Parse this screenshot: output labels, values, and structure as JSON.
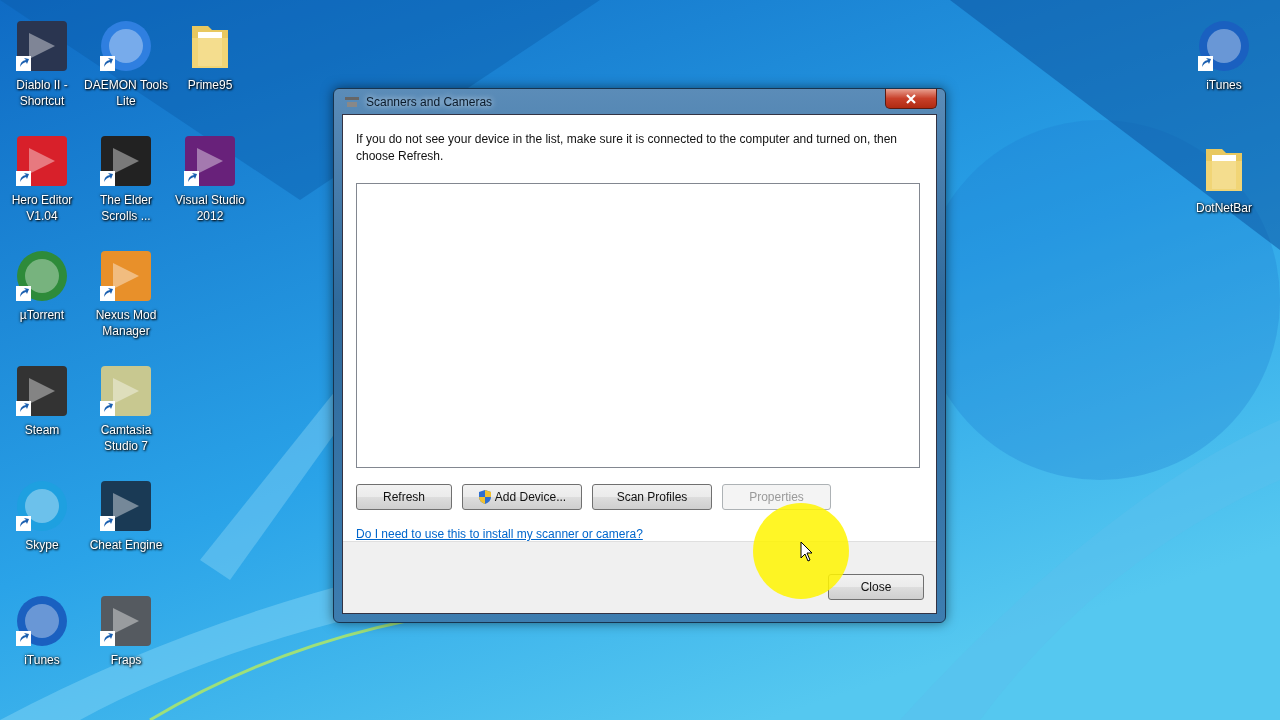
{
  "desktop": {
    "icon_rows": [
      [
        {
          "label": "Diablo II - Shortcut",
          "kind": "app",
          "color": "#2a3550",
          "shortcut": true
        },
        {
          "label": "DAEMON Tools Lite",
          "kind": "disc",
          "color": "#2f7fe0",
          "shortcut": true
        },
        {
          "label": "Prime95",
          "kind": "folder",
          "shortcut": false
        }
      ],
      [
        {
          "label": "Hero Editor V1.04",
          "kind": "app",
          "color": "#d8202a",
          "shortcut": true
        },
        {
          "label": "The Elder Scrolls ...",
          "kind": "app",
          "color": "#222222",
          "shortcut": true
        },
        {
          "label": "Visual Studio 2012",
          "kind": "app",
          "color": "#68217a",
          "shortcut": true
        }
      ],
      [
        {
          "label": "µTorrent",
          "kind": "disc",
          "color": "#2e8b3a",
          "shortcut": true
        },
        {
          "label": "Nexus Mod Manager",
          "kind": "app",
          "color": "#e8902a",
          "shortcut": true
        }
      ],
      [
        {
          "label": "Steam",
          "kind": "app",
          "color": "#333333",
          "shortcut": true
        },
        {
          "label": "Camtasia Studio 7",
          "kind": "app",
          "color": "#c8c890",
          "shortcut": true
        }
      ],
      [
        {
          "label": "Skype",
          "kind": "disc",
          "color": "#1ea0e0",
          "shortcut": true
        },
        {
          "label": "Cheat Engine",
          "kind": "app",
          "color": "#1a3a55",
          "shortcut": true
        }
      ],
      [
        {
          "label": "iTunes",
          "kind": "disc",
          "color": "#1a60c0",
          "shortcut": true
        },
        {
          "label": "Fraps",
          "kind": "app",
          "color": "#555a60",
          "shortcut": true
        }
      ]
    ],
    "right_icons": [
      {
        "label": "iTunes",
        "kind": "disc",
        "color": "#1a60c0",
        "shortcut": true
      },
      {
        "label": "DotNetBar",
        "kind": "folder",
        "shortcut": false
      }
    ]
  },
  "window": {
    "title": "Scanners and Cameras",
    "instructions": "If you do not see your device in the list, make sure it is connected to the computer and turned on, then choose Refresh.",
    "buttons": [
      {
        "label": "Refresh",
        "disabled": false,
        "shield": false
      },
      {
        "label": "Add Device...",
        "disabled": false,
        "shield": true
      },
      {
        "label": "Scan Profiles",
        "disabled": false,
        "shield": false
      },
      {
        "label": "Properties",
        "disabled": true,
        "shield": false
      }
    ],
    "help_link": "Do I need to use this to install my scanner or camera?",
    "close_button": "Close"
  }
}
